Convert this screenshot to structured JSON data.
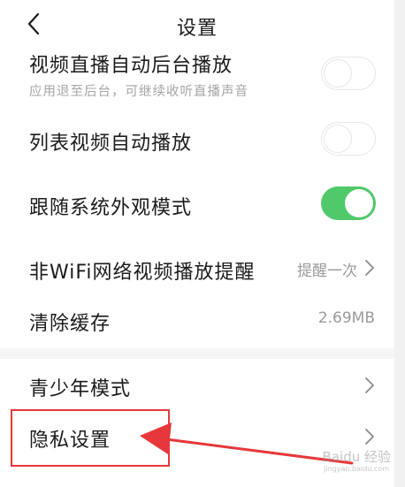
{
  "nav": {
    "title": "设置",
    "back_icon": "chevron-left-icon"
  },
  "settings": [
    {
      "label": "视频直播自动后台播放",
      "subtitle": "应用退至后台，可继续收听直播声音",
      "control": "toggle",
      "toggle_on": false
    },
    {
      "label": "列表视频自动播放",
      "control": "toggle",
      "toggle_on": false
    },
    {
      "label": "跟随系统外观模式",
      "control": "toggle",
      "toggle_on": true
    },
    {
      "label": "非WiFi网络视频播放提醒",
      "control": "link",
      "value": "提醒一次"
    },
    {
      "label": "清除缓存",
      "control": "value",
      "value": "2.69MB"
    },
    {
      "label": "青少年模式",
      "control": "link"
    },
    {
      "label": "隐私设置",
      "control": "link"
    }
  ],
  "colors": {
    "toggle_on": "#4fc96a",
    "toggle_off_border": "#e6e6e6",
    "annotation_red": "#e6383b",
    "secondary_text": "#9a9a9a"
  },
  "annotation": {
    "highlight_color": "#e6383b"
  },
  "watermark": {
    "brand": "Baidu 经验",
    "url": "jingyan.baidu.com"
  }
}
